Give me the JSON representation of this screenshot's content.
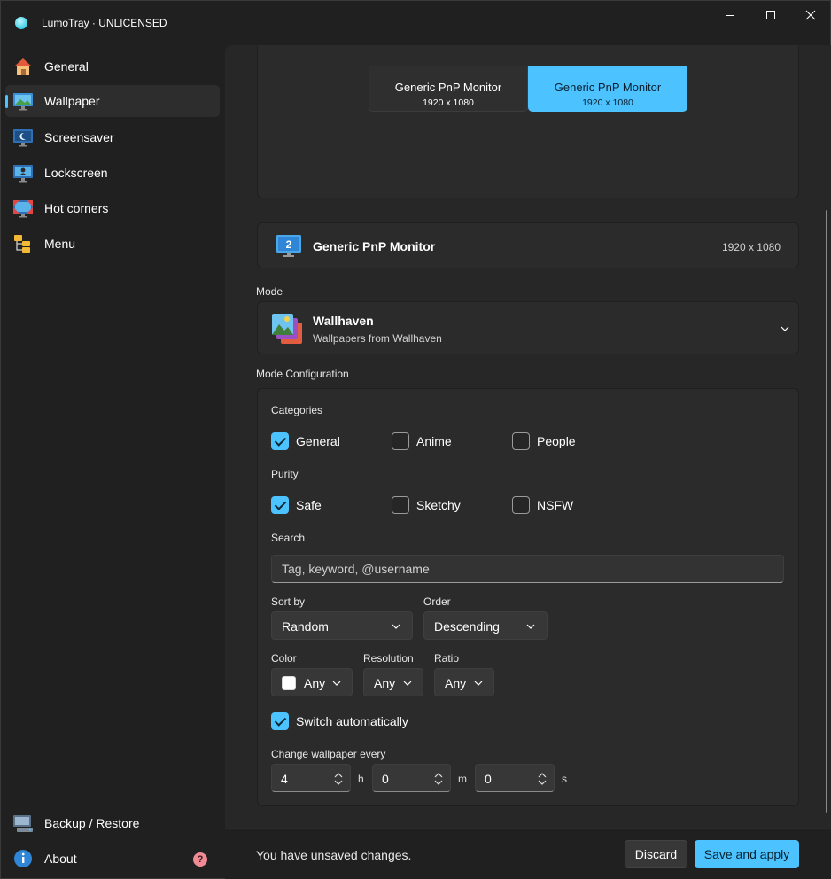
{
  "window": {
    "title": "LumoTray · UNLICENSED",
    "minimize_glyph": "",
    "close_glyph": "✕"
  },
  "sidebar": {
    "items": [
      {
        "label": "General",
        "icon": "home-icon"
      },
      {
        "label": "Wallpaper",
        "icon": "wallpaper-icon",
        "active": true
      },
      {
        "label": "Screensaver",
        "icon": "screensaver-icon"
      },
      {
        "label": "Lockscreen",
        "icon": "lockscreen-icon"
      },
      {
        "label": "Hot corners",
        "icon": "hot-corners-icon"
      },
      {
        "label": "Menu",
        "icon": "menu-tree-icon"
      }
    ],
    "footer": [
      {
        "label": "Backup / Restore",
        "icon": "backup-icon"
      },
      {
        "label": "About",
        "icon": "info-icon",
        "badge": "?"
      }
    ]
  },
  "monitors": [
    {
      "name": "Generic PnP Monitor",
      "resolution": "1920 x 1080",
      "selected": false
    },
    {
      "name": "Generic PnP Monitor",
      "resolution": "1920 x 1080",
      "selected": true
    }
  ],
  "selected_monitor": {
    "number": "2",
    "name": "Generic PnP Monitor",
    "resolution": "1920 x 1080"
  },
  "mode": {
    "label": "Mode",
    "title": "Wallhaven",
    "subtitle": "Wallpapers from Wallhaven"
  },
  "config": {
    "label": "Mode Configuration",
    "categories_label": "Categories",
    "categories": [
      {
        "label": "General",
        "checked": true
      },
      {
        "label": "Anime",
        "checked": false
      },
      {
        "label": "People",
        "checked": false
      }
    ],
    "purity_label": "Purity",
    "purity": [
      {
        "label": "Safe",
        "checked": true
      },
      {
        "label": "Sketchy",
        "checked": false
      },
      {
        "label": "NSFW",
        "checked": false
      }
    ],
    "search_label": "Search",
    "search_placeholder": "Tag, keyword, @username",
    "search_value": "",
    "sort_label": "Sort by",
    "sort_value": "Random",
    "order_label": "Order",
    "order_value": "Descending",
    "color_label": "Color",
    "color_value": "Any",
    "resolution_label": "Resolution",
    "resolution_value": "Any",
    "ratio_label": "Ratio",
    "ratio_value": "Any",
    "switch_auto_label": "Switch automatically",
    "switch_auto_checked": true,
    "interval_label": "Change wallpaper every",
    "hours": "4",
    "hours_unit": "h",
    "minutes": "0",
    "minutes_unit": "m",
    "seconds": "0",
    "seconds_unit": "s"
  },
  "footer": {
    "unsaved_text": "You have unsaved changes.",
    "discard_label": "Discard",
    "save_label": "Save and apply"
  },
  "colors": {
    "accent": "#4cc2ff",
    "background": "#202020",
    "card": "#2b2b2b"
  }
}
